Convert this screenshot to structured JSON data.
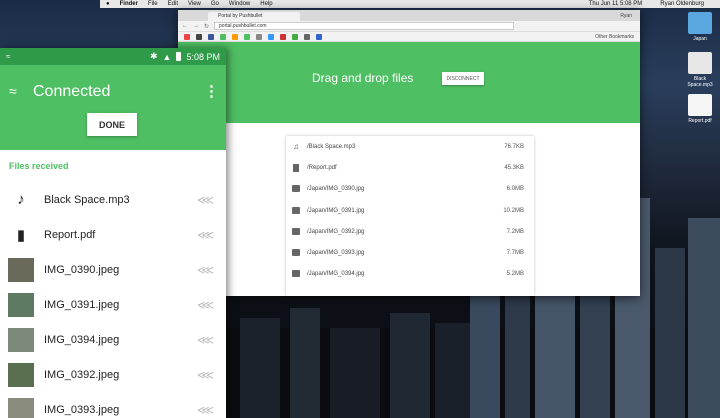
{
  "mac": {
    "menu": [
      "Finder",
      "File",
      "Edit",
      "View",
      "Go",
      "Window",
      "Help"
    ],
    "clock": "Thu Jun 11  5:08 PM",
    "user": "Ryan Oldenburg",
    "desktop_icons": [
      {
        "label": "Japan"
      },
      {
        "label": "Black Space.mp3"
      },
      {
        "label": "Report.pdf"
      }
    ]
  },
  "browser": {
    "tab_title": "Portal by Pushbullet",
    "profile": "Ryan",
    "url": "portal.pushbullet.com",
    "other_bookmarks": "Other Bookmarks",
    "header_text": "Drag and drop files",
    "disconnect_label": "DISCONNECT",
    "files": [
      {
        "icon": "music-note-icon",
        "name": "/Black Space.mp3",
        "size": "76.7KB"
      },
      {
        "icon": "document-icon",
        "name": "/Report.pdf",
        "size": "45.3KB"
      },
      {
        "icon": "image-icon",
        "name": "/Japan/IMG_0390.jpg",
        "size": "6.0MB"
      },
      {
        "icon": "image-icon",
        "name": "/Japan/IMG_0391.jpg",
        "size": "10.2MB"
      },
      {
        "icon": "image-icon",
        "name": "/Japan/IMG_0392.jpg",
        "size": "7.2MB"
      },
      {
        "icon": "image-icon",
        "name": "/Japan/IMG_0393.jpg",
        "size": "7.7MB"
      },
      {
        "icon": "image-icon",
        "name": "/Japan/IMG_0394.jpg",
        "size": "5.2MB"
      }
    ]
  },
  "phone": {
    "time": "5:08 PM",
    "title": "Connected",
    "done_label": "DONE",
    "section_label": "Files received",
    "files": [
      {
        "name": "Black Space.mp3",
        "kind": "audio"
      },
      {
        "name": "Report.pdf",
        "kind": "doc"
      },
      {
        "name": "IMG_0390.jpeg",
        "kind": "image",
        "thumb": "#6b6a5a"
      },
      {
        "name": "IMG_0391.jpeg",
        "kind": "image",
        "thumb": "#5f7a62"
      },
      {
        "name": "IMG_0394.jpeg",
        "kind": "image",
        "thumb": "#7c8a7a"
      },
      {
        "name": "IMG_0392.jpeg",
        "kind": "image",
        "thumb": "#5a6e50"
      },
      {
        "name": "IMG_0393.jpeg",
        "kind": "image",
        "thumb": "#8a8c7e"
      }
    ]
  },
  "colors": {
    "accent": "#4fbf63",
    "status_bar": "#2f9a47"
  }
}
